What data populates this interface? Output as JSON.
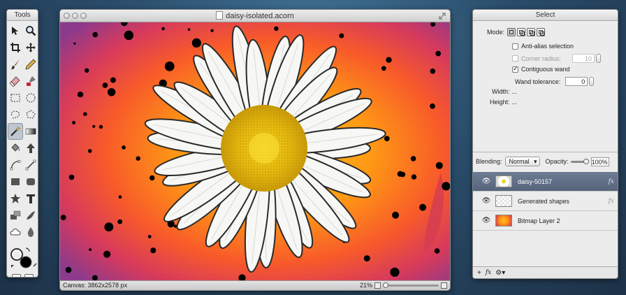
{
  "tools_panel": {
    "title": "Tools",
    "tools": [
      {
        "name": "move-tool-icon",
        "selected": false
      },
      {
        "name": "zoom-tool-icon",
        "selected": false
      },
      {
        "name": "crop-tool-icon",
        "selected": false
      },
      {
        "name": "pan-tool-icon",
        "selected": false
      },
      {
        "name": "brush-tool-icon",
        "selected": false
      },
      {
        "name": "pencil-tool-icon",
        "selected": false
      },
      {
        "name": "eraser-tool-icon",
        "selected": false
      },
      {
        "name": "clone-tool-icon",
        "selected": false
      },
      {
        "name": "rect-select-icon",
        "selected": false
      },
      {
        "name": "ellipse-select-icon",
        "selected": false
      },
      {
        "name": "lasso-select-icon",
        "selected": false
      },
      {
        "name": "polygon-lasso-icon",
        "selected": false
      },
      {
        "name": "magic-wand-icon",
        "selected": true
      },
      {
        "name": "gradient-tool-icon",
        "selected": false
      },
      {
        "name": "paint-bucket-icon",
        "selected": false
      },
      {
        "name": "dodge-arrow-icon",
        "selected": false
      },
      {
        "name": "bezier-tool-icon",
        "selected": false
      },
      {
        "name": "line-tool-icon",
        "selected": false
      },
      {
        "name": "rect-shape-icon",
        "selected": false
      },
      {
        "name": "rounded-rect-icon",
        "selected": false
      },
      {
        "name": "star-shape-icon",
        "selected": false
      },
      {
        "name": "text-tool-icon",
        "selected": false
      },
      {
        "name": "text-effects-icon",
        "selected": false
      },
      {
        "name": "smudge-tool-icon",
        "selected": false
      },
      {
        "name": "cloud-shape-icon",
        "selected": false
      },
      {
        "name": "blur-drop-icon",
        "selected": false
      }
    ],
    "colors": {
      "stroke": "#ffffff",
      "fill": "#000000"
    }
  },
  "document": {
    "title": "daisy-isolated.acorn",
    "status_canvas": "Canvas: 3862x2578 px",
    "zoom": "21%"
  },
  "select_panel": {
    "title": "Select",
    "mode_label": "Mode:",
    "anti_alias": {
      "label": "Anti-alias selection",
      "checked": false
    },
    "corner_radius": {
      "label": "Corner radius:",
      "checked": false,
      "value": "10"
    },
    "contiguous_wand": {
      "label": "Contiguous wand",
      "checked": true
    },
    "wand_tolerance": {
      "label": "Wand tolerance:",
      "value": "0"
    },
    "width": {
      "label": "Width:",
      "value": "..."
    },
    "height": {
      "label": "Height:",
      "value": "..."
    },
    "blending": {
      "label": "Blending:",
      "value": "Normal"
    },
    "opacity": {
      "label": "Opacity:",
      "value": "100%"
    },
    "layers": [
      {
        "name": "daisy-50157",
        "selected": true,
        "fx": "fx"
      },
      {
        "name": "Generated shapes",
        "selected": false,
        "fx": "fx"
      },
      {
        "name": "Bitmap Layer 2",
        "selected": false,
        "fx": ""
      }
    ],
    "footer": {
      "add": "+",
      "fx": "fx",
      "gear": "⚙▾"
    }
  }
}
